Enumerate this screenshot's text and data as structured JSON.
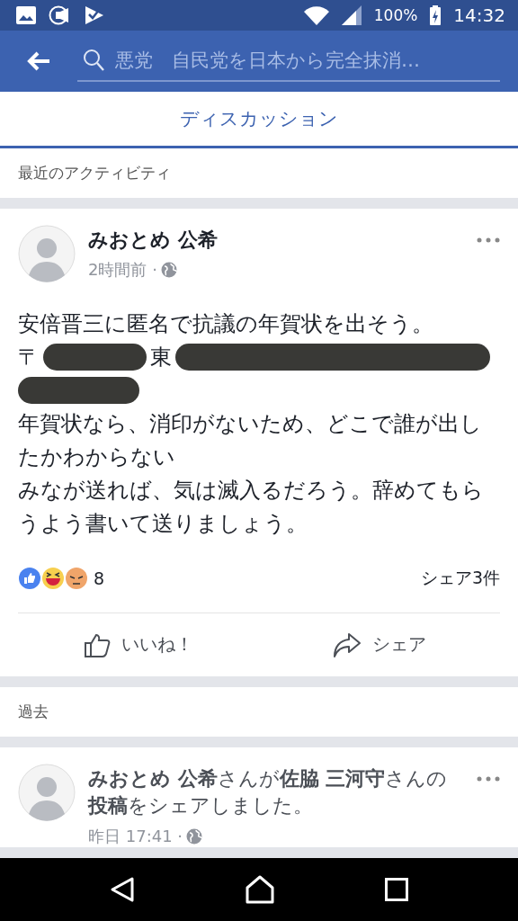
{
  "status_bar": {
    "battery": "100%",
    "time": "14:32"
  },
  "search": {
    "value": "悪党　自民党を日本から完全抹消…"
  },
  "tabs": [
    {
      "label": "ディスカッション",
      "selected": true
    }
  ],
  "sections": [
    {
      "heading": "最近のアクティビティ",
      "posts": [
        {
          "author": "みおとめ 公希",
          "time": "2時間前 ·",
          "body": [
            {
              "kind": "text",
              "text": "安倍晋三に匿名で抗議の年賀状を出そう。"
            },
            {
              "kind": "redacted",
              "parts": [
                "〒",
                "東"
              ]
            },
            {
              "kind": "redacted"
            },
            {
              "kind": "text",
              "text": "年賀状なら、消印がないため、どこで誰が出したかわからない"
            },
            {
              "kind": "text",
              "text": "みなが送れば、気は滅入るだろう。辞めてもらうよう書いて送りましょう。"
            }
          ],
          "reaction_count": "8",
          "shares": "シェア3件",
          "actions": [
            "いいね！",
            "シェア"
          ]
        }
      ]
    },
    {
      "heading": "過去",
      "posts": [
        {
          "headline": "**みおとめ 公希**さんが**佐脇 三河守**さんの**投稿**をシェアしました。",
          "time": "昨日 17:41 ·"
        }
      ]
    }
  ]
}
